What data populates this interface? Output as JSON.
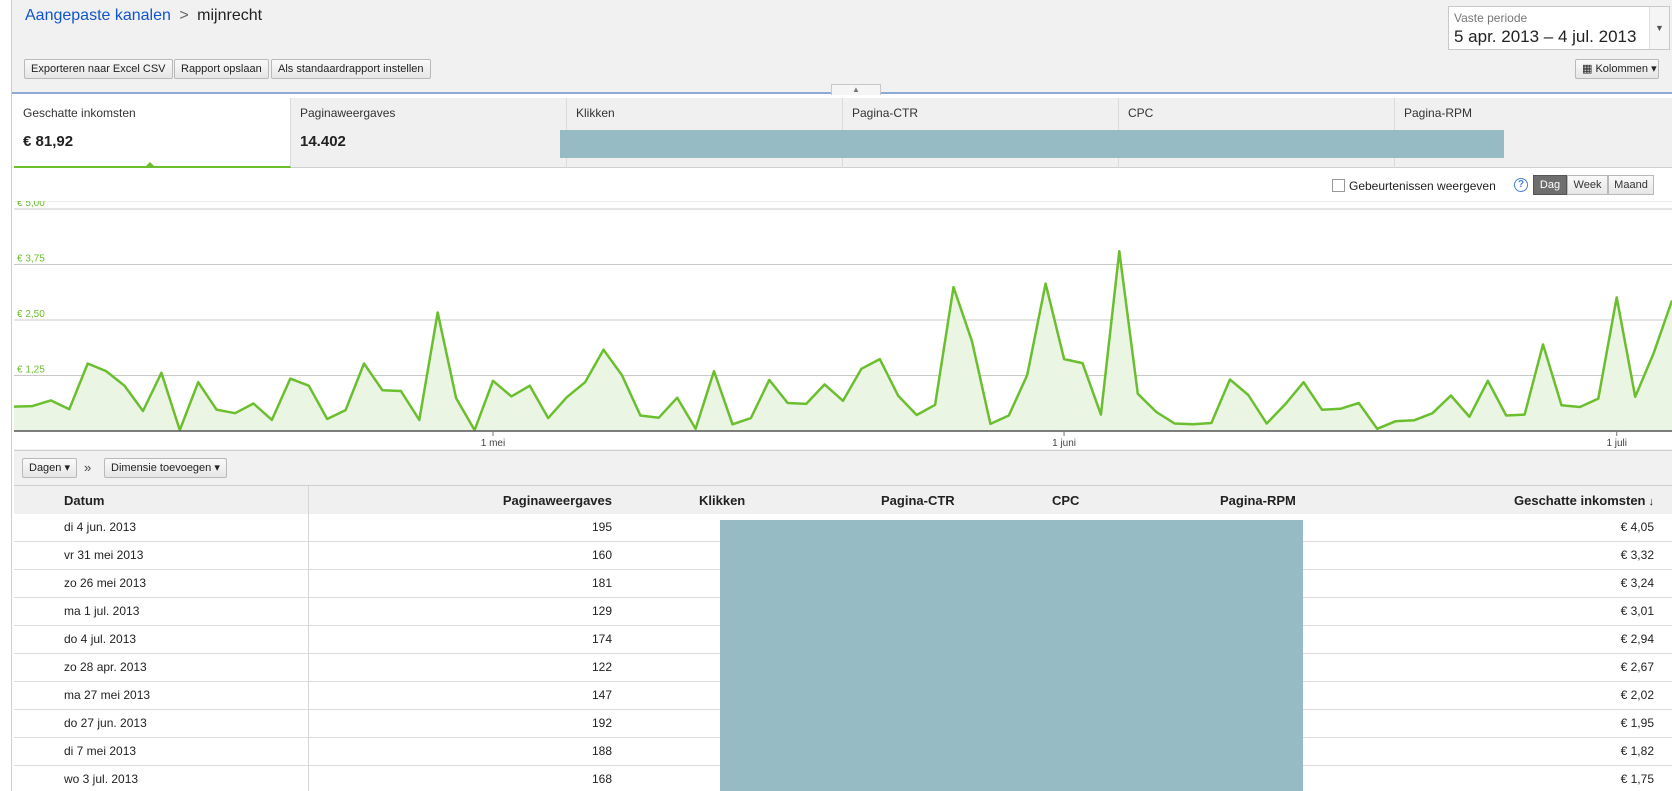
{
  "breadcrumb": {
    "parent": "Aangepaste kanalen",
    "separator": ">",
    "current": "mijnrecht"
  },
  "toolbar": {
    "export_label": "Exporteren naar Excel CSV",
    "save_label": "Rapport opslaan",
    "default_label": "Als standaardrapport instellen",
    "columns_label": "Kolommen"
  },
  "period": {
    "label": "Vaste periode",
    "range": "5 apr. 2013 – 4 jul. 2013"
  },
  "metrics": [
    {
      "label": "Geschatte inkomsten",
      "value": "€ 81,92"
    },
    {
      "label": "Paginaweergaves",
      "value": "14.402"
    },
    {
      "label": "Klikken",
      "value": ""
    },
    {
      "label": "Pagina-CTR",
      "value": ""
    },
    {
      "label": "CPC",
      "value": ""
    },
    {
      "label": "Pagina-RPM",
      "value": ""
    }
  ],
  "chart_controls": {
    "events_label": "Gebeurtenissen weergeven",
    "help_glyph": "?",
    "granularity": [
      "Dag",
      "Week",
      "Maand"
    ],
    "active_granularity": "Dag"
  },
  "chart_data": {
    "type": "area",
    "ylabel": "",
    "y_ticks": [
      "€ 5,00",
      "€ 3,75",
      "€ 2,50",
      "€ 1,25"
    ],
    "ylim": [
      0,
      5
    ],
    "x_labels": [
      {
        "label": "1 mei",
        "index": 26
      },
      {
        "label": "1 juni",
        "index": 57
      },
      {
        "label": "1 juli",
        "index": 87
      }
    ],
    "line_color": "#6bbf2f",
    "fill_color": "#eaf5e3",
    "values": [
      0.55,
      0.56,
      0.69,
      0.49,
      1.52,
      1.35,
      1.02,
      0.45,
      1.31,
      0.02,
      1.1,
      0.48,
      0.4,
      0.62,
      0.25,
      1.18,
      1.02,
      0.27,
      0.47,
      1.52,
      0.92,
      0.9,
      0.25,
      2.67,
      0.74,
      0.02,
      1.13,
      0.78,
      1.02,
      0.29,
      0.76,
      1.1,
      1.83,
      1.26,
      0.35,
      0.3,
      0.75,
      0.05,
      1.35,
      0.15,
      0.29,
      1.15,
      0.63,
      0.61,
      1.05,
      0.68,
      1.4,
      1.62,
      0.79,
      0.36,
      0.59,
      3.24,
      2.02,
      0.16,
      0.35,
      1.26,
      3.32,
      1.62,
      1.53,
      0.37,
      4.05,
      0.84,
      0.43,
      0.17,
      0.15,
      0.18,
      1.16,
      0.81,
      0.17,
      0.6,
      1.1,
      0.48,
      0.5,
      0.63,
      0.05,
      0.22,
      0.24,
      0.4,
      0.8,
      0.32,
      1.13,
      0.35,
      0.37,
      1.95,
      0.58,
      0.54,
      0.73,
      3.01,
      0.77,
      1.75,
      2.94
    ]
  },
  "table_controls": {
    "dim_label": "Dagen",
    "separator": "»",
    "add_dimension_label": "Dimensie toevoegen"
  },
  "table": {
    "headers": {
      "date": "Datum",
      "pageviews": "Paginaweergaves",
      "clicks": "Klikken",
      "ctr": "Pagina-CTR",
      "cpc": "CPC",
      "rpm": "Pagina-RPM",
      "earnings": "Geschatte inkomsten",
      "sort_glyph": "↓"
    },
    "rows": [
      {
        "date": "di 4 jun. 2013",
        "pageviews": "195",
        "earnings": "€ 4,05"
      },
      {
        "date": "vr 31 mei 2013",
        "pageviews": "160",
        "earnings": "€ 3,32"
      },
      {
        "date": "zo 26 mei 2013",
        "pageviews": "181",
        "earnings": "€ 3,24"
      },
      {
        "date": "ma 1 jul. 2013",
        "pageviews": "129",
        "earnings": "€ 3,01"
      },
      {
        "date": "do 4 jul. 2013",
        "pageviews": "174",
        "earnings": "€ 2,94"
      },
      {
        "date": "zo 28 apr. 2013",
        "pageviews": "122",
        "earnings": "€ 2,67"
      },
      {
        "date": "ma 27 mei 2013",
        "pageviews": "147",
        "earnings": "€ 2,02"
      },
      {
        "date": "do 27 jun. 2013",
        "pageviews": "192",
        "earnings": "€ 1,95"
      },
      {
        "date": "di 7 mei 2013",
        "pageviews": "188",
        "earnings": "€ 1,82"
      },
      {
        "date": "wo 3 jul. 2013",
        "pageviews": "168",
        "earnings": "€ 1,75"
      }
    ]
  }
}
